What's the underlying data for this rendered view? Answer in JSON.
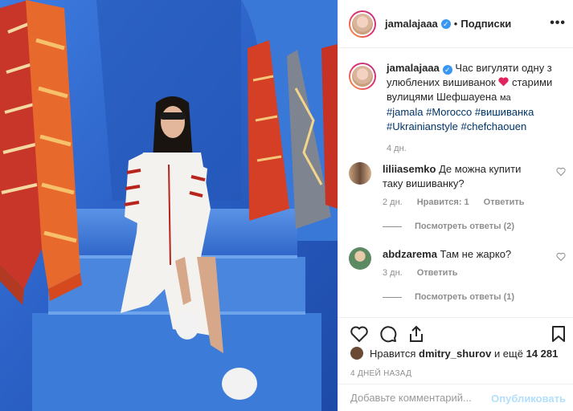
{
  "header": {
    "username": "jamalajaaa",
    "separator": "•",
    "follow_label": "Подписки",
    "more_label": "•••"
  },
  "caption": {
    "username": "jamalajaaa",
    "text_1": "Час вигуляти одну з улюблених вишиванок",
    "text_2": "старими вулицями Шефшауена",
    "text_3": "ма",
    "tags": [
      "#jamala",
      "#Morocco",
      "#вишиванка",
      "#Ukrainianstyle",
      "#chefchaouen"
    ],
    "time": "4 дн."
  },
  "comments": [
    {
      "username": "liliiasemko",
      "text": "Де можна купити таку вишиванку?",
      "time": "2 дн.",
      "likes": "Нравится: 1",
      "reply": "Ответить",
      "replies": "Посмотреть ответы (2)"
    },
    {
      "username": "abdzarema",
      "text": "Там не жарко?",
      "time": "3 дн.",
      "reply": "Ответить",
      "replies": "Посмотреть ответы (1)"
    }
  ],
  "likes": {
    "prefix": "Нравится",
    "user": "dmitry_shurov",
    "suffix": "и ещё",
    "count": "14 281"
  },
  "posted_ago": "4 ДНЕЙ НАЗАД",
  "add_comment": {
    "placeholder": "Добавьте комментарий...",
    "publish_label": "Опубликовать"
  },
  "icons": {
    "like": "heart-icon",
    "comment": "comment-icon",
    "share": "share-icon",
    "save": "bookmark-icon",
    "verified": "verified-badge-icon"
  },
  "colors": {
    "link": "#003569",
    "verified": "#3897f0",
    "muted": "#8e8e8e",
    "publish_disabled": "#b2dffc",
    "heart_emoji": "#e0245e"
  }
}
